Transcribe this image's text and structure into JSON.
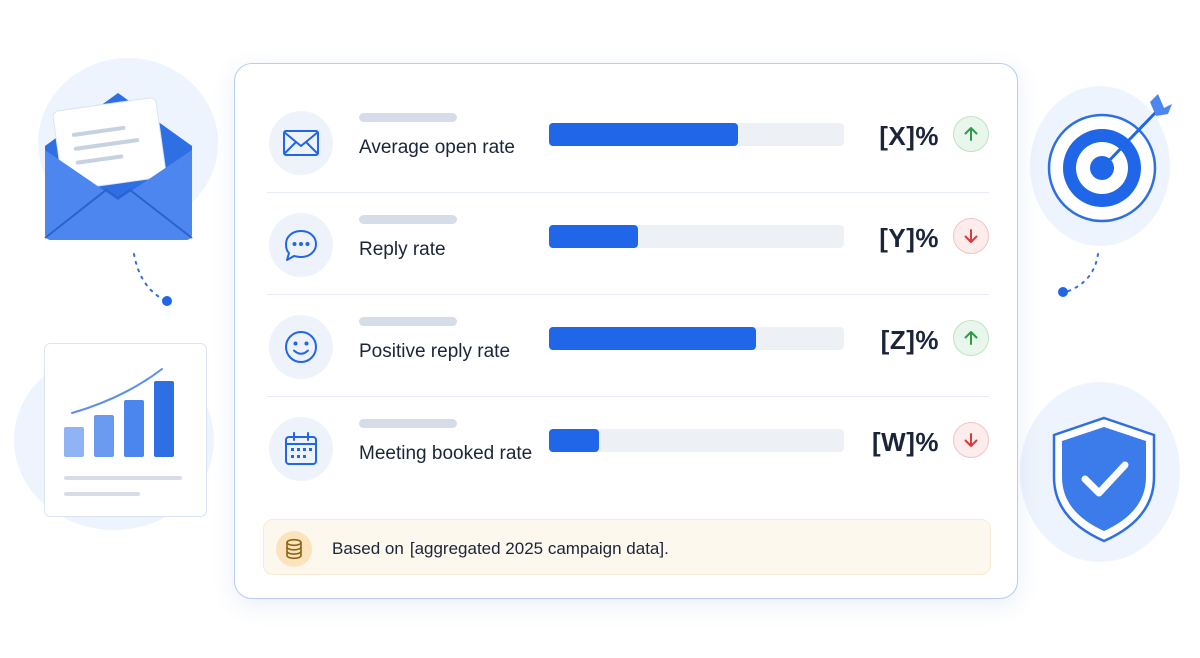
{
  "metrics": [
    {
      "label": "Average open rate",
      "value": "[X]%",
      "trend": "up",
      "fill": 0.64,
      "icon": "envelope-icon"
    },
    {
      "label": "Reply rate",
      "value": "[Y]%",
      "trend": "down",
      "fill": 0.3,
      "icon": "chat-bubble-icon"
    },
    {
      "label": "Positive reply rate",
      "value": "[Z]%",
      "trend": "up",
      "fill": 0.7,
      "icon": "smiley-face-icon"
    },
    {
      "label": "Meeting booked rate",
      "value": "[W]%",
      "trend": "down",
      "fill": 0.17,
      "icon": "calendar-icon"
    }
  ],
  "source": {
    "prefix": "Based on",
    "text": "[aggregated 2025 campaign data]."
  },
  "colors": {
    "accent": "#1f66e8",
    "up": "#2e9c46",
    "down": "#d93a3a",
    "track": "#edf0f5"
  }
}
